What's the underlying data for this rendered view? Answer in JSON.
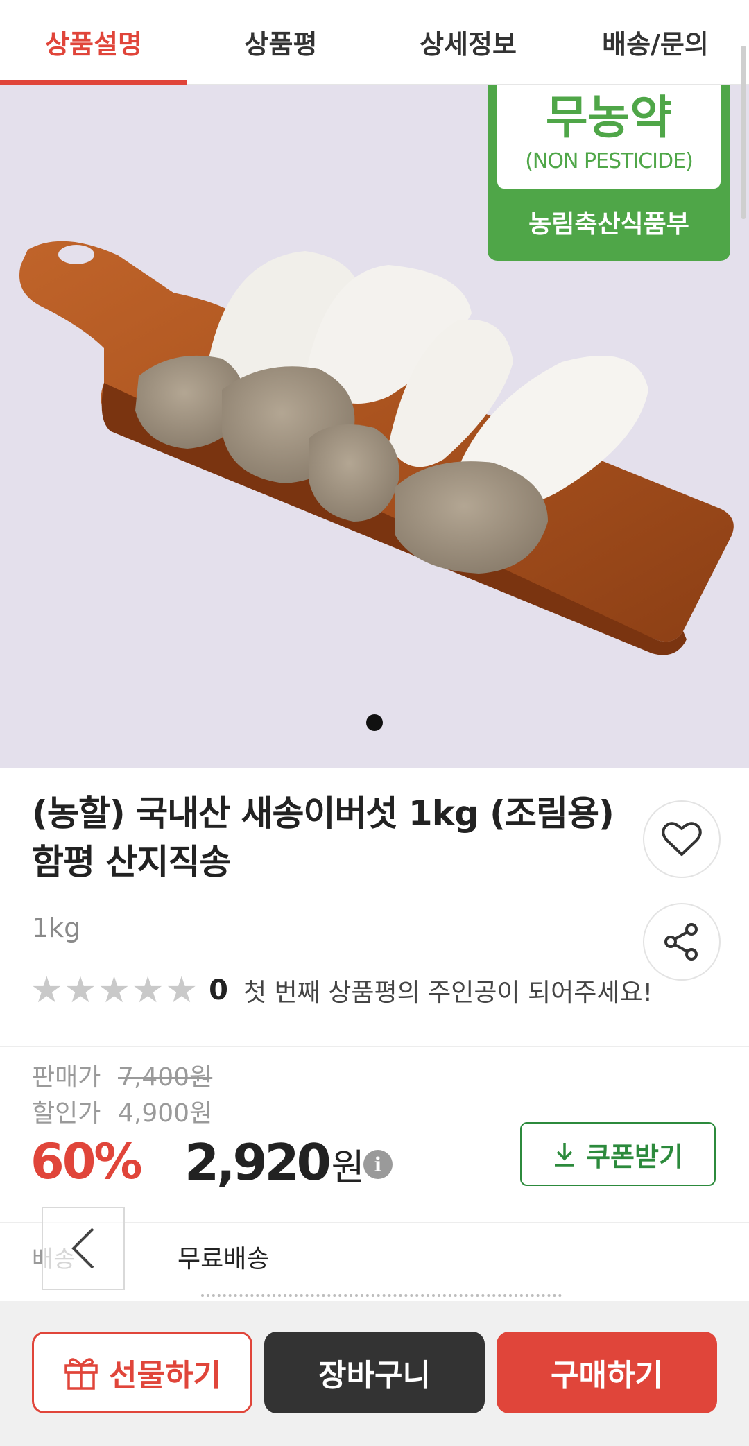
{
  "tabs": [
    {
      "label": "상품설명",
      "active": true
    },
    {
      "label": "상품평",
      "active": false
    },
    {
      "label": "상세정보",
      "active": false
    },
    {
      "label": "배송/문의",
      "active": false
    }
  ],
  "hero": {
    "certification": {
      "korean": "무농약",
      "english": "(NON PESTICIDE)",
      "issuer": "농림축산식품부"
    },
    "current_slide": 1
  },
  "product": {
    "title_line1": "(농할) 국내산 새송이버섯 1kg (조림용)",
    "title_line2": "함평 산지직송",
    "weight": "1kg",
    "rating_stars": 0,
    "review_count": "0",
    "review_prompt": "첫 번째 상품평의 주인공이 되어주세요!"
  },
  "pricing": {
    "sale_label": "판매가",
    "sale_price": "7,400원",
    "discount_label": "할인가",
    "discount_price": "4,900원",
    "discount_rate": "60%",
    "final_price": "2,920",
    "currency": "원",
    "info_icon": "i",
    "coupon_button": "쿠폰받기"
  },
  "shipping": {
    "label": "배송",
    "value": "무료배송"
  },
  "bottom_bar": {
    "gift": "선물하기",
    "cart": "장바구니",
    "buy": "구매하기"
  },
  "colors": {
    "accent": "#e0453a",
    "coupon_green": "#2c8a3c",
    "cert_green": "#4fa648",
    "dark_button": "#333333"
  }
}
